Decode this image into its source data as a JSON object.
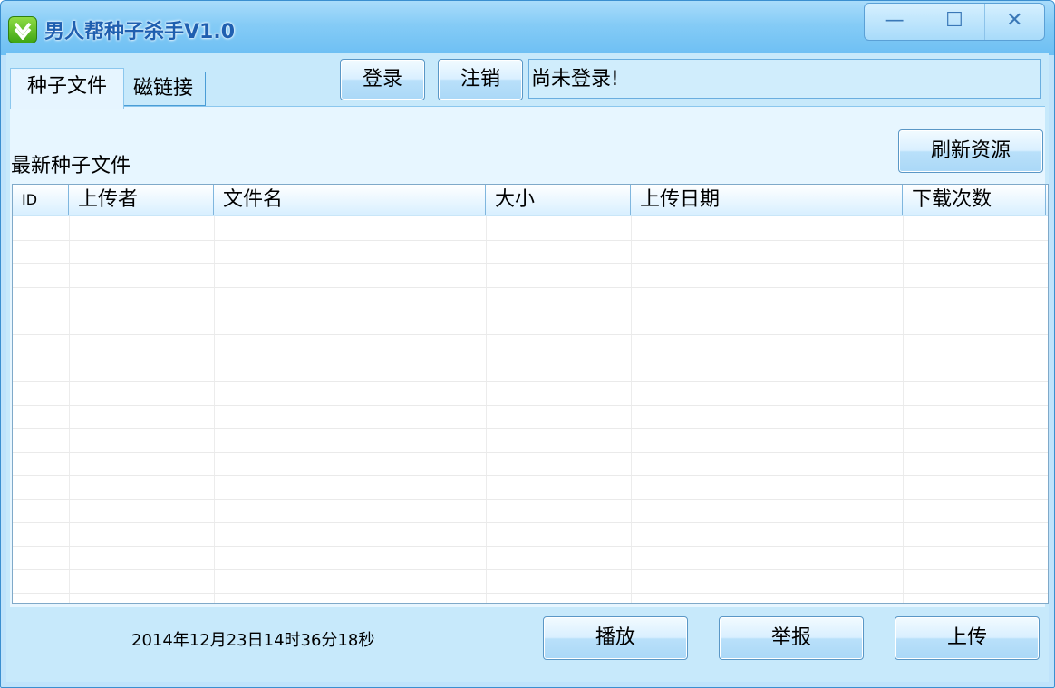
{
  "window": {
    "title": "男人帮种子杀手V1.0",
    "controls": {
      "minimize": "—",
      "maximize": "☐",
      "close": "✕"
    }
  },
  "tabs": [
    {
      "label": "种子文件",
      "active": true
    },
    {
      "label": "磁链接",
      "active": false
    }
  ],
  "account": {
    "login_label": "登录",
    "logout_label": "注销",
    "status_text": "尚未登录!"
  },
  "section": {
    "title": "最新种子文件",
    "refresh_label": "刷新资源"
  },
  "table": {
    "columns": [
      "ID",
      "上传者",
      "文件名",
      "大小",
      "上传日期",
      "下载次数"
    ],
    "rows": []
  },
  "footer": {
    "timestamp": "2014年12月23日14时36分18秒",
    "play_label": "播放",
    "report_label": "举报",
    "upload_label": "上传"
  },
  "colors": {
    "titlebar": "#84cbf6",
    "client": "#c7e9fb",
    "title_text": "#1f5fb0"
  }
}
